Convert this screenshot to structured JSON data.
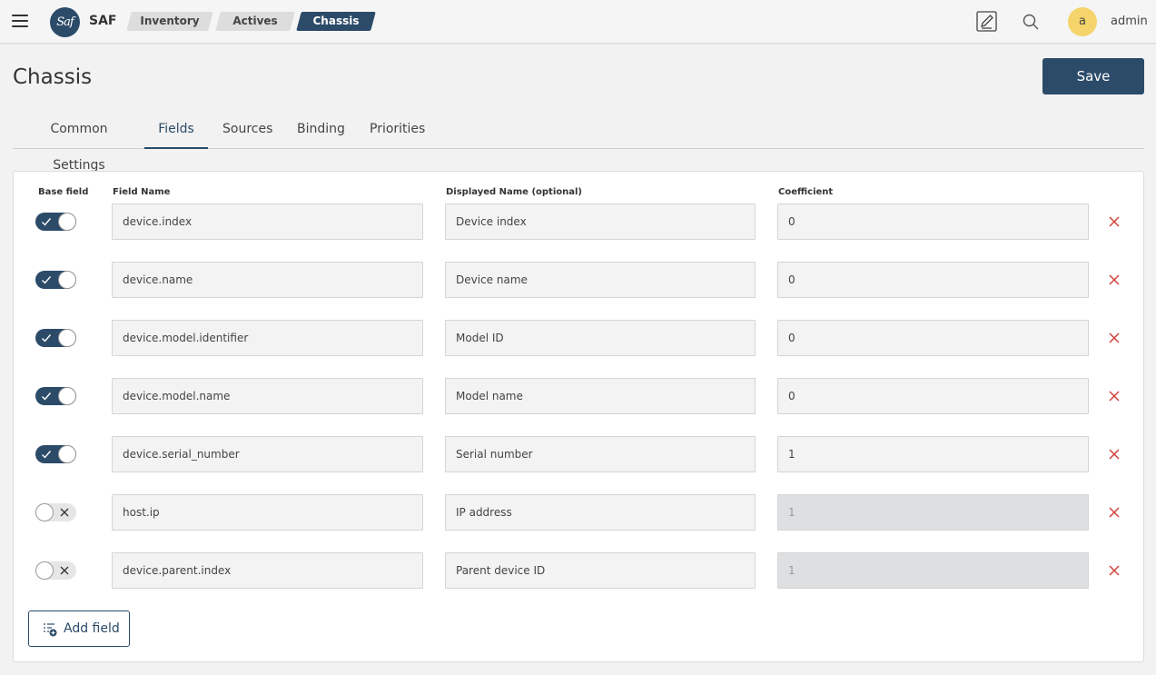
{
  "app": {
    "logo_text": "Saf",
    "name": "SAF"
  },
  "breadcrumbs": [
    "Inventory",
    "Actives",
    "Chassis"
  ],
  "user": {
    "avatar_letter": "a",
    "name": "admin"
  },
  "page": {
    "title": "Chassis",
    "save_label": "Save"
  },
  "tabs": [
    {
      "label": "Common Settings",
      "active": false
    },
    {
      "label": "Fields",
      "active": true
    },
    {
      "label": "Sources",
      "active": false
    },
    {
      "label": "Binding",
      "active": false
    },
    {
      "label": "Priorities",
      "active": false
    }
  ],
  "columns": {
    "base_field": "Base field",
    "field_name": "Field Name",
    "displayed_name": "Displayed Name (optional)",
    "coefficient": "Coefficient"
  },
  "fields": [
    {
      "base": true,
      "field_name": "device.index",
      "displayed_name": "Device index",
      "coefficient": "0"
    },
    {
      "base": true,
      "field_name": "device.name",
      "displayed_name": "Device name",
      "coefficient": "0"
    },
    {
      "base": true,
      "field_name": "device.model.identifier",
      "displayed_name": "Model ID",
      "coefficient": "0"
    },
    {
      "base": true,
      "field_name": "device.model.name",
      "displayed_name": "Model name",
      "coefficient": "0"
    },
    {
      "base": true,
      "field_name": "device.serial_number",
      "displayed_name": "Serial number",
      "coefficient": "1"
    },
    {
      "base": false,
      "field_name": "host.ip",
      "displayed_name": "IP address",
      "coefficient": "1"
    },
    {
      "base": false,
      "field_name": "device.parent.index",
      "displayed_name": "Parent device ID",
      "coefficient": "1"
    }
  ],
  "add_field_label": "Add field",
  "colors": {
    "primary": "#2b4b69",
    "delete": "#d0413a",
    "avatar": "#f4d46b"
  }
}
